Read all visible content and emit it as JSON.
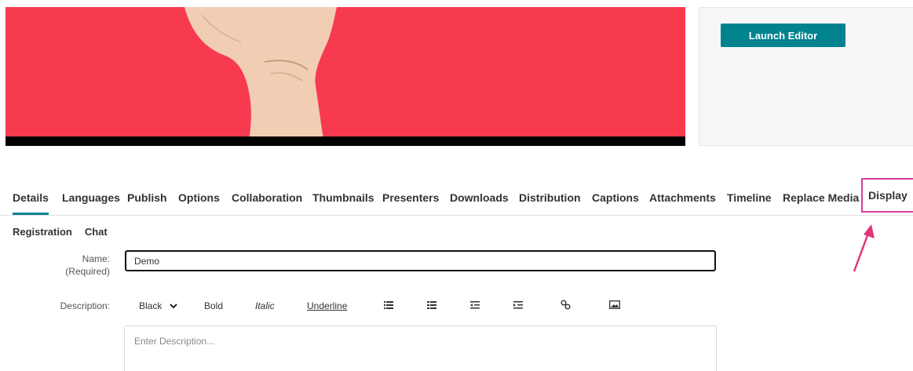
{
  "launch_editor_label": "Launch Editor",
  "tabs": [
    "Details",
    "Languages",
    "Publish",
    "Options",
    "Collaboration",
    "Thumbnails",
    "Presenters",
    "Downloads",
    "Distribution",
    "Captions",
    "Attachments",
    "Timeline",
    "Replace Media",
    "Display"
  ],
  "active_tab": "Details",
  "highlighted_tab": "Display",
  "subtabs": [
    "Registration",
    "Chat"
  ],
  "form": {
    "name_label": "Name:",
    "name_required": "(Required)",
    "name_value": "Demo",
    "description_label": "Description:",
    "description_placeholder": "Enter Description..."
  },
  "toolbar": {
    "color": "Black",
    "bold": "Bold",
    "italic": "Italic",
    "underline": "Underline"
  },
  "colors": {
    "accent": "#00838f",
    "video_bg": "#f83a4f",
    "highlight": "#d63c9b"
  }
}
